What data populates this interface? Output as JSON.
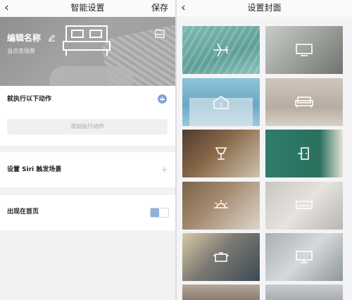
{
  "left": {
    "nav": {
      "back_icon": "chevron-left",
      "title": "智能设置",
      "save": "保存"
    },
    "hero": {
      "name": "编辑名称",
      "hint": "当点击场景",
      "icons": [
        "bed-icon",
        "image-icon",
        "pencil-icon"
      ]
    },
    "actions": {
      "label": "就执行以下动作",
      "add_button": "添加执行动作"
    },
    "siri": {
      "label": "设置 Siri 触发场景"
    },
    "home": {
      "label": "出现在首页",
      "toggle_on": false
    }
  },
  "right": {
    "nav": {
      "back_icon": "chevron-left",
      "title": "设置封面"
    },
    "covers": [
      {
        "icon": "airplane-icon"
      },
      {
        "icon": "tv-icon"
      },
      {
        "icon": "house-icon"
      },
      {
        "icon": "sofa-icon"
      },
      {
        "icon": "glass-icon"
      },
      {
        "icon": "door-icon"
      },
      {
        "icon": "sun-icon"
      },
      {
        "icon": "air-conditioner-icon"
      },
      {
        "icon": "pot-icon"
      },
      {
        "icon": "monitor-icon"
      },
      {
        "icon": ""
      },
      {
        "icon": ""
      }
    ]
  },
  "colors": {
    "accent": "#7e9fd6",
    "toggle": "#8eb3d8"
  }
}
